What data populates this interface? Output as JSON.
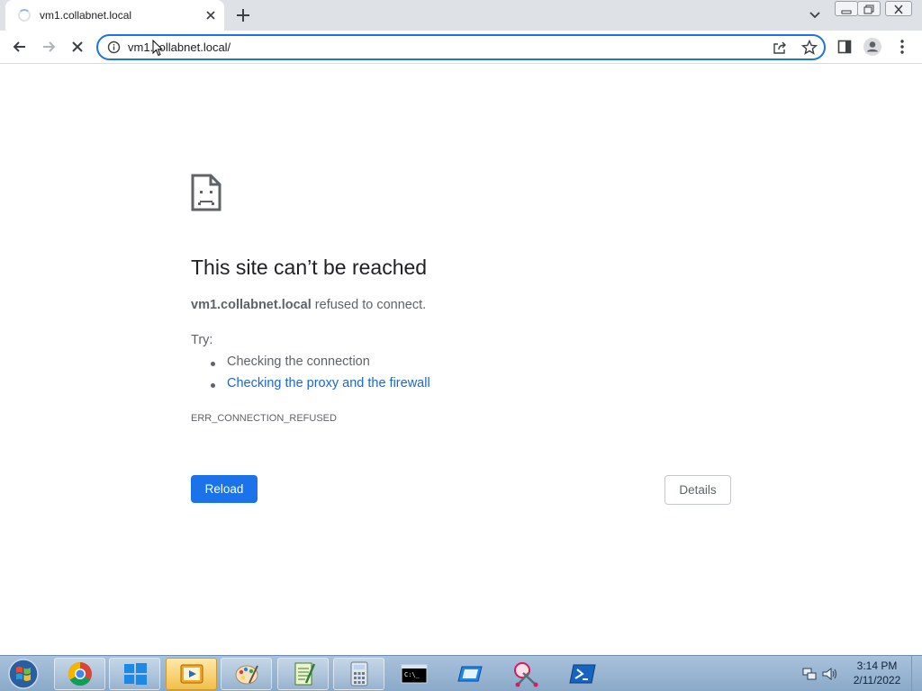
{
  "browser": {
    "tab": {
      "title": "vm1.collabnet.local",
      "loading": true
    },
    "omnibox": {
      "url": "vm1.collabnet.local/"
    }
  },
  "error_page": {
    "title": "This site can’t be reached",
    "host": "vm1.collabnet.local",
    "message_suffix": " refused to connect.",
    "try_label": "Try:",
    "suggestions": [
      "Checking the connection",
      "Checking the proxy and the firewall"
    ],
    "error_code": "ERR_CONNECTION_REFUSED",
    "reload_label": "Reload",
    "details_label": "Details"
  },
  "taskbar": {
    "items": [
      "chrome-icon",
      "windows-icon",
      "media-player-icon",
      "paint-icon",
      "notepad-icon",
      "calculator-icon",
      "cmd-icon",
      "remote-desktop-icon",
      "snipping-tool-icon",
      "powershell-icon"
    ],
    "clock": {
      "time": "3:14 PM",
      "date": "2/11/2022"
    }
  },
  "colors": {
    "accent": "#1a73e8",
    "link": "#1967d2",
    "text": "#202124",
    "muted": "#5f6368"
  }
}
